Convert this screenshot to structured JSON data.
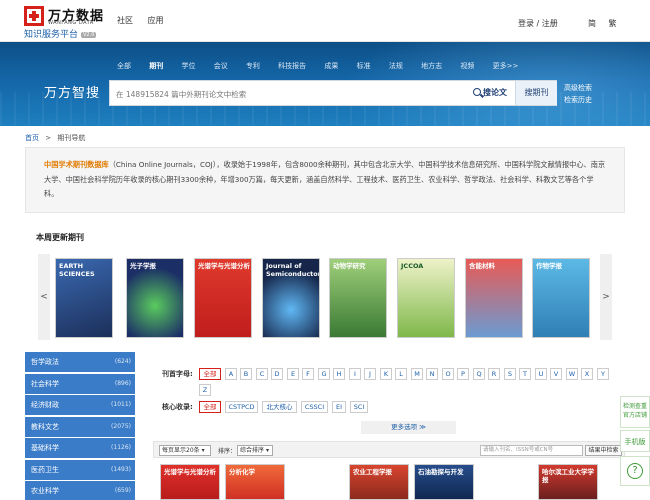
{
  "header": {
    "logo_cn": "万方数据",
    "logo_en": "WANFANG DATA",
    "logo_sub": "知识服务平台",
    "logo_version": "V2.0",
    "nav": [
      "社区",
      "应用"
    ],
    "login": "登录 / 注册",
    "lang": [
      "简",
      "繁"
    ]
  },
  "banner": {
    "categories": [
      "全部",
      "期刊",
      "学位",
      "会议",
      "专利",
      "科技报告",
      "成果",
      "标准",
      "法规",
      "地方志",
      "视频",
      "更多>>"
    ],
    "active_category": "期刊",
    "brand": "万方智搜",
    "search_placeholder": "在 148915824 篇中外期刊论文中检索",
    "search_button": "搜论文",
    "search_journal_button": "搜期刊",
    "advanced": "高级检索",
    "history": "检索历史"
  },
  "breadcrumb": {
    "home": "首页",
    "sep": ">",
    "current": "期刊导航"
  },
  "intro": {
    "highlight": "中国学术期刊数据库",
    "text": "（China Online Journals，COJ），收录始于1998年，包含8000余种期刊，其中包含北京大学、中国科学技术信息研究所、中国科学院文献情报中心、南京大学、中国社会科学院历年收录的核心期刊3300余种，年增300万篇，每天更新，涵盖自然科学、工程技术、医药卫生、农业科学、哲学政法、社会科学、科教文艺等各个学科。"
  },
  "weekly": {
    "title": "本周更新期刊",
    "prev": "<",
    "next": ">",
    "covers": [
      {
        "title": "EARTH SCIENCES",
        "color": "#2b4f8a"
      },
      {
        "title": "光子学报",
        "color": "#1d2f66"
      },
      {
        "title": "光谱学与光谱分析",
        "color": "#d72a26"
      },
      {
        "title": "Journal of Semiconductors",
        "color": "#1d2c52"
      },
      {
        "title": "动物学研究",
        "color": "#3d8a3a"
      },
      {
        "title": "JCCOA",
        "color": "#c8d27a"
      },
      {
        "title": "含能材料",
        "color": "#d94340"
      },
      {
        "title": "作物学报",
        "color": "#3a96c8"
      }
    ]
  },
  "sidebar": [
    {
      "label": "哲学政法",
      "count": "(624)"
    },
    {
      "label": "社会科学",
      "count": "(896)"
    },
    {
      "label": "经济财政",
      "count": "(1011)"
    },
    {
      "label": "教科文艺",
      "count": "(2075)"
    },
    {
      "label": "基础科学",
      "count": "(1126)"
    },
    {
      "label": "医药卫生",
      "count": "(1493)"
    },
    {
      "label": "农业科学",
      "count": "(659)"
    }
  ],
  "filters": {
    "initial_label": "刊首字母:",
    "letters": [
      "全部",
      "A",
      "B",
      "C",
      "D",
      "E",
      "F",
      "G",
      "H",
      "I",
      "J",
      "K",
      "L",
      "M",
      "N",
      "O",
      "P",
      "Q",
      "R",
      "S",
      "T",
      "U",
      "V",
      "W",
      "X",
      "Y",
      "Z"
    ],
    "core_label": "核心收录:",
    "core": [
      "全部",
      "CSTPCD",
      "北大核心",
      "CSSCI",
      "EI",
      "SCI"
    ],
    "more": "更多选项 ≫"
  },
  "sortbar": {
    "per_page": "每页显示20条",
    "sort_label": "排序：",
    "sort_value": "综合排序",
    "search_placeholder": "请输入刊名、ISSN号或CN号",
    "search_button": "结果中检索"
  },
  "results": [
    {
      "title": "光谱学与光谱分析",
      "color": "#d72a26"
    },
    {
      "title": "分析化学",
      "color": "#e44530"
    },
    {
      "title": "农业工程学报",
      "color": "#c23a2a"
    },
    {
      "title": "石油勘探与开发",
      "color": "#1b3a70"
    },
    {
      "title": "哈尔滨工业大学学报",
      "color": "#c62828"
    }
  ],
  "float": {
    "service": "检测查重 官方店铺",
    "mobile": "手机版",
    "help": "?"
  }
}
